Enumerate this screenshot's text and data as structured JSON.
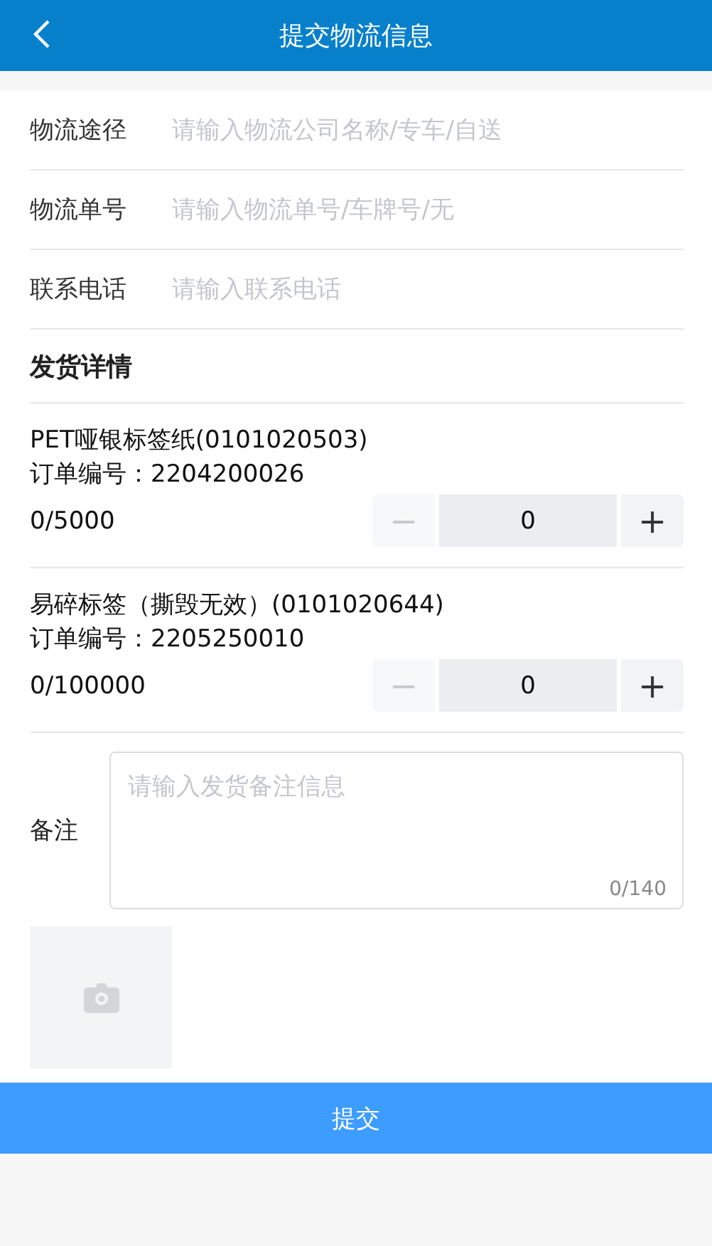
{
  "header": {
    "title": "提交物流信息"
  },
  "fields": [
    {
      "label": "物流途径",
      "placeholder": "请输入物流公司名称/专车/自送"
    },
    {
      "label": "物流单号",
      "placeholder": "请输入物流单号/车牌号/无"
    },
    {
      "label": "联系电话",
      "placeholder": "请输入联系电话"
    }
  ],
  "section_title": "发货详情",
  "goods": [
    {
      "name": "PET哑银标签纸(0101020503)",
      "order": "订单编号：2204200026",
      "progress": "0/5000",
      "stepper": {
        "minus": "−",
        "value": "0",
        "plus": "+",
        "minus_disabled": true
      }
    },
    {
      "name": "易碎标签（撕毁无效）(0101020644)",
      "order": "订单编号：2205250010",
      "progress": "0/100000",
      "stepper": {
        "minus": "−",
        "value": "0",
        "plus": "+",
        "minus_disabled": true
      }
    }
  ],
  "remark": {
    "label": "备注",
    "placeholder": "请输入发货备注信息",
    "counter": "0/140"
  },
  "submit": {
    "label": "提交"
  }
}
